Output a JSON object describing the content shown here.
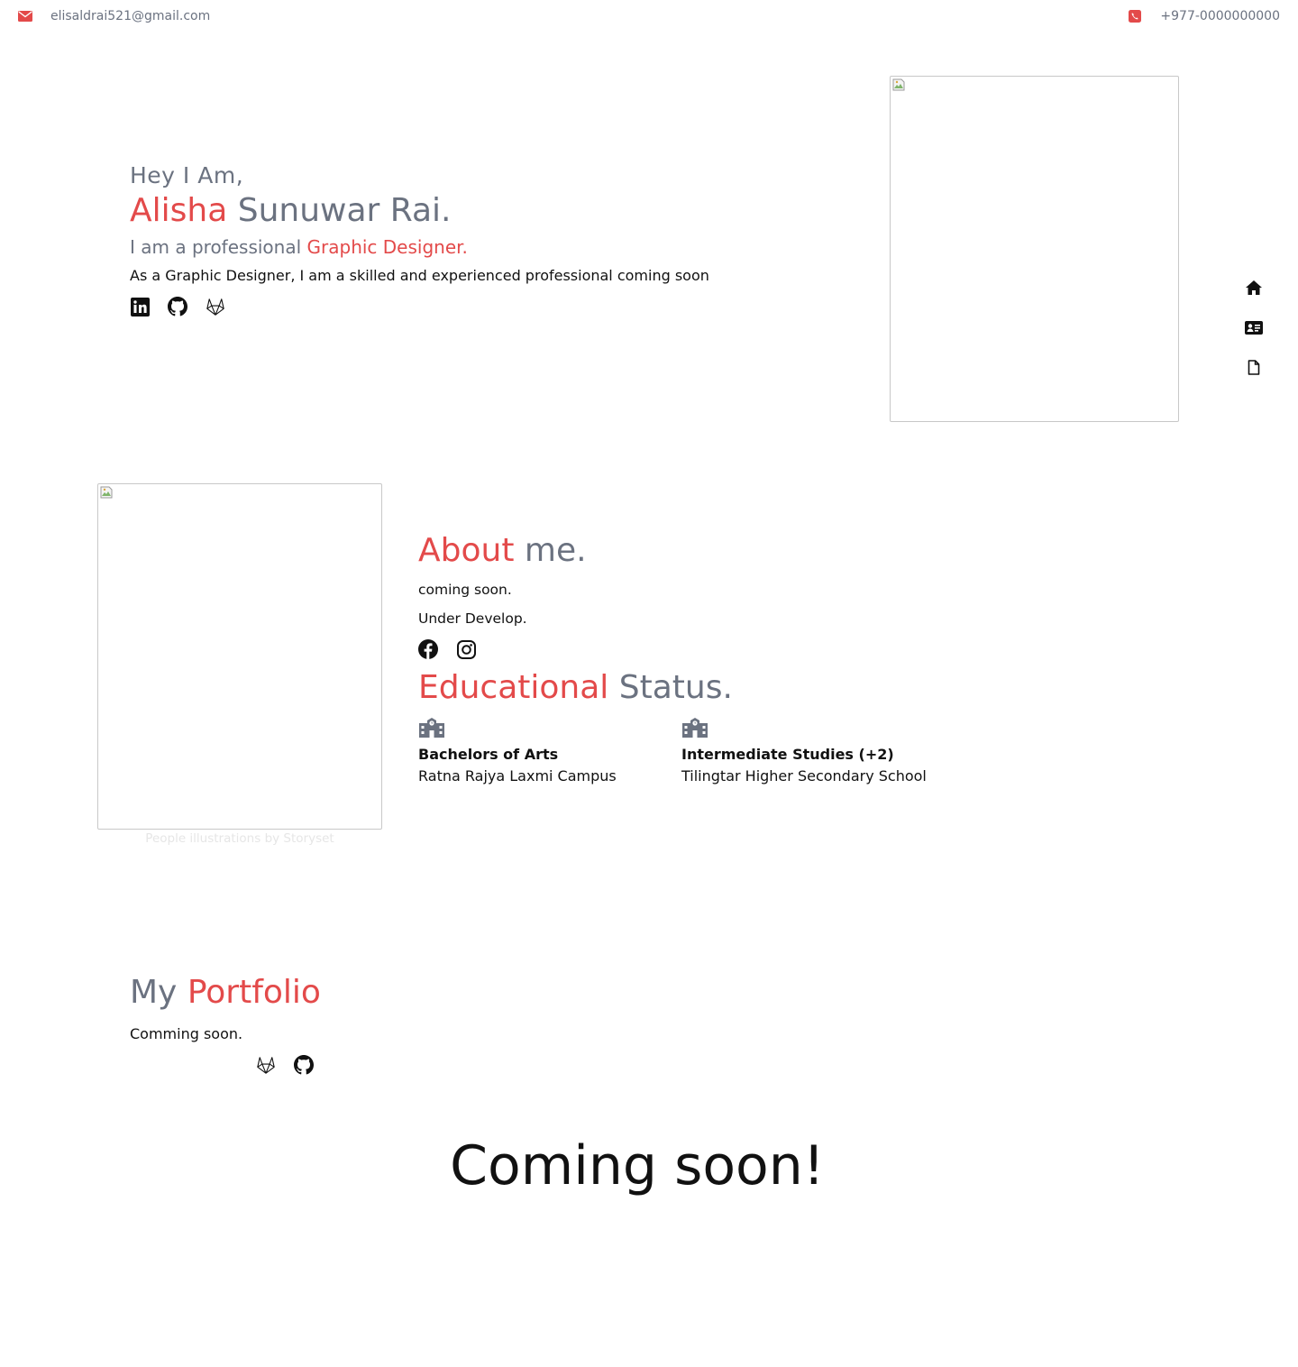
{
  "topbar": {
    "email": "elisaldrai521@gmail.com",
    "phone": "+977-0000000000"
  },
  "hero": {
    "greeting": "Hey I Am,",
    "first_name": "Alisha",
    "last_name": "Sunuwar Rai.",
    "role_prefix": "I am a professional",
    "role": "Graphic Designer.",
    "description": "As a Graphic Designer, I am a skilled and experienced professional coming soon",
    "socials": [
      "linkedin-icon",
      "github-icon",
      "gitlab-icon"
    ]
  },
  "sidenav": [
    "home-icon",
    "contact-card-icon",
    "file-icon"
  ],
  "about": {
    "title_accent": "About",
    "title_rest": "me.",
    "line1": "coming soon.",
    "line2": "Under Develop.",
    "socials": [
      "facebook-icon",
      "instagram-icon"
    ],
    "image_credit": "People illustrations by Storyset"
  },
  "education": {
    "title_accent": "Educational",
    "title_rest": "Status.",
    "items": [
      {
        "degree": "Bachelors of Arts",
        "school": "Ratna Rajya Laxmi Campus"
      },
      {
        "degree": "Intermediate Studies (+2)",
        "school": "Tilingtar Higher Secondary School"
      }
    ]
  },
  "portfolio": {
    "title_rest": "My",
    "title_accent": "Portfolio",
    "text": "Comming soon.",
    "socials": [
      "gitlab-icon",
      "github-icon"
    ]
  },
  "footer": {
    "coming_soon": "Coming soon!"
  },
  "colors": {
    "accent": "#e34a4a",
    "muted": "#6b7280",
    "text": "#111111"
  }
}
